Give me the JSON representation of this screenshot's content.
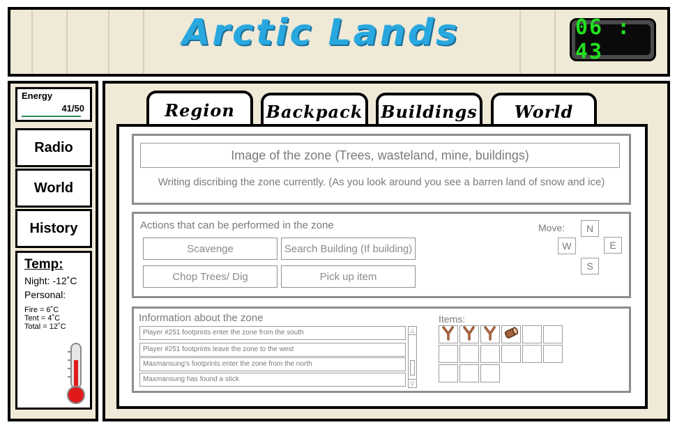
{
  "game": {
    "title": "Arctic Lands",
    "clock": "06 : 43"
  },
  "sidebar": {
    "energy_label": "Energy",
    "energy_value": "41/50",
    "energy_fraction": 0.82,
    "buttons": [
      "Radio",
      "World",
      "History"
    ],
    "temp": {
      "title": "Temp:",
      "night": "Night: -12˚C",
      "personal": "Personal:",
      "fire": "Fire = 6˚C",
      "tent": "Tent = 4˚C",
      "total": "Total = 12˚C"
    }
  },
  "tabs": [
    "Region",
    "Backpack",
    "Buildings",
    "World"
  ],
  "zone": {
    "image_placeholder": "Image of the zone (Trees, wasteland, mine, buildings)",
    "description": "Writing discribing the zone currently. (As you look around you see a barren land of snow and ice)"
  },
  "actions": {
    "heading": "Actions that can be performed in the zone",
    "buttons": [
      "Scavenge",
      "Search Building (If building)",
      "Chop Trees/ Dig",
      "Pick up item"
    ],
    "move_label": "Move:",
    "directions": {
      "n": "N",
      "w": "W",
      "e": "E",
      "s": "S"
    }
  },
  "info": {
    "heading": "Information about the zone",
    "log": [
      "Player #251 footprints enter the zone from the south",
      "Player #251 footprints leave the zone to the west",
      "Maxmansung's footprints enter the zone from the north",
      "Maxmansung has found a stick"
    ],
    "items_label": "Items:",
    "items": [
      "stick-icon",
      "stick-icon",
      "stick-icon",
      "log-icon",
      "",
      "",
      "",
      "",
      "",
      "",
      "",
      "",
      "",
      "",
      ""
    ]
  },
  "colors": {
    "title": "#29a8e0",
    "clock_digits": "#22e01e",
    "panel_bg": "#efe9d7",
    "thermometer": "#e01a1a"
  }
}
